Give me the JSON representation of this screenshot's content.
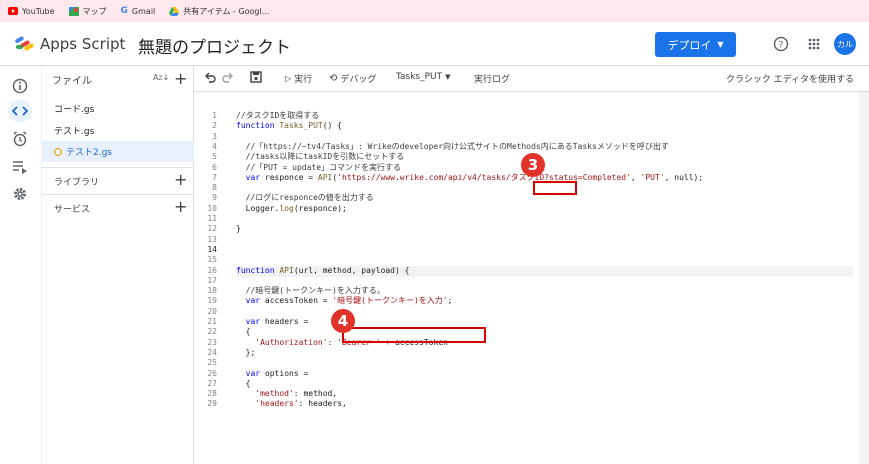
{
  "bookmarks": [
    "YouTube",
    "マップ",
    "Gmail",
    "共有アイテム - Googl..."
  ],
  "app": {
    "name": "Apps Script",
    "project_title": "無題のプロジェクト"
  },
  "header": {
    "deploy_label": "デプロイ",
    "avatar_text": "カル"
  },
  "files_panel": {
    "title": "ファイル",
    "files": [
      "コード.gs",
      "テスト.gs",
      "テスト2.gs"
    ],
    "active_file": "テスト2.gs",
    "sections": [
      "ライブラリ",
      "サービス"
    ]
  },
  "toolbar": {
    "run_label": "実行",
    "debug_label": "デバッグ",
    "function_select": "Tasks_PUT",
    "log_label": "実行ログ",
    "classic_label": "クラシック エディタを使用する"
  },
  "code_lines": [
    {
      "n": "1",
      "t": "//タスクIDを取得する"
    },
    {
      "n": "2",
      "t": "function Tasks_PUT() {"
    },
    {
      "n": "3",
      "t": ""
    },
    {
      "n": "4",
      "t": "  //「https://~tv4/Tasks」: Wrikeのdeveloper向け公式サイトのMethods内にあるTasksメソッドを呼び出す"
    },
    {
      "n": "5",
      "t": "  //tasks以降にtaskIDを引数にセットする"
    },
    {
      "n": "6",
      "t": "  //「PUT = update」コマンドを実行する"
    },
    {
      "n": "7",
      "t": "  var responce = API('https://www.wrike.com/api/v4/tasks/タスクID?status=Completed', 'PUT', null);"
    },
    {
      "n": "8",
      "t": ""
    },
    {
      "n": "9",
      "t": "  //ログにresponceの値を出力する"
    },
    {
      "n": "10",
      "t": "  Logger.log(responce);"
    },
    {
      "n": "11",
      "t": ""
    },
    {
      "n": "12",
      "t": "}"
    },
    {
      "n": "13",
      "t": ""
    },
    {
      "n": "14",
      "t": ""
    },
    {
      "n": "15",
      "t": ""
    },
    {
      "n": "16",
      "t": "function API(url, method, payload) {"
    },
    {
      "n": "17",
      "t": ""
    },
    {
      "n": "18",
      "t": "  //暗号鍵(トークンキー)を入力する。"
    },
    {
      "n": "19",
      "t": "  var accessToken = '暗号鍵(トークンキー)を入力';"
    },
    {
      "n": "20",
      "t": ""
    },
    {
      "n": "21",
      "t": "  var headers ="
    },
    {
      "n": "22",
      "t": "  {"
    },
    {
      "n": "23",
      "t": "    'Authorization': 'Bearer ' + accessToken"
    },
    {
      "n": "24",
      "t": "  };"
    },
    {
      "n": "25",
      "t": ""
    },
    {
      "n": "26",
      "t": "  var options ="
    },
    {
      "n": "27",
      "t": "  {"
    },
    {
      "n": "28",
      "t": "    'method': method,"
    },
    {
      "n": "29",
      "t": "    'headers': headers,"
    }
  ],
  "markers": {
    "m3": "3",
    "m4": "4"
  },
  "colors": {
    "accent": "#1a73e8",
    "marker": "#e2332a",
    "highlight": "#d40000",
    "bookmark_bar": "#fde8ee"
  }
}
